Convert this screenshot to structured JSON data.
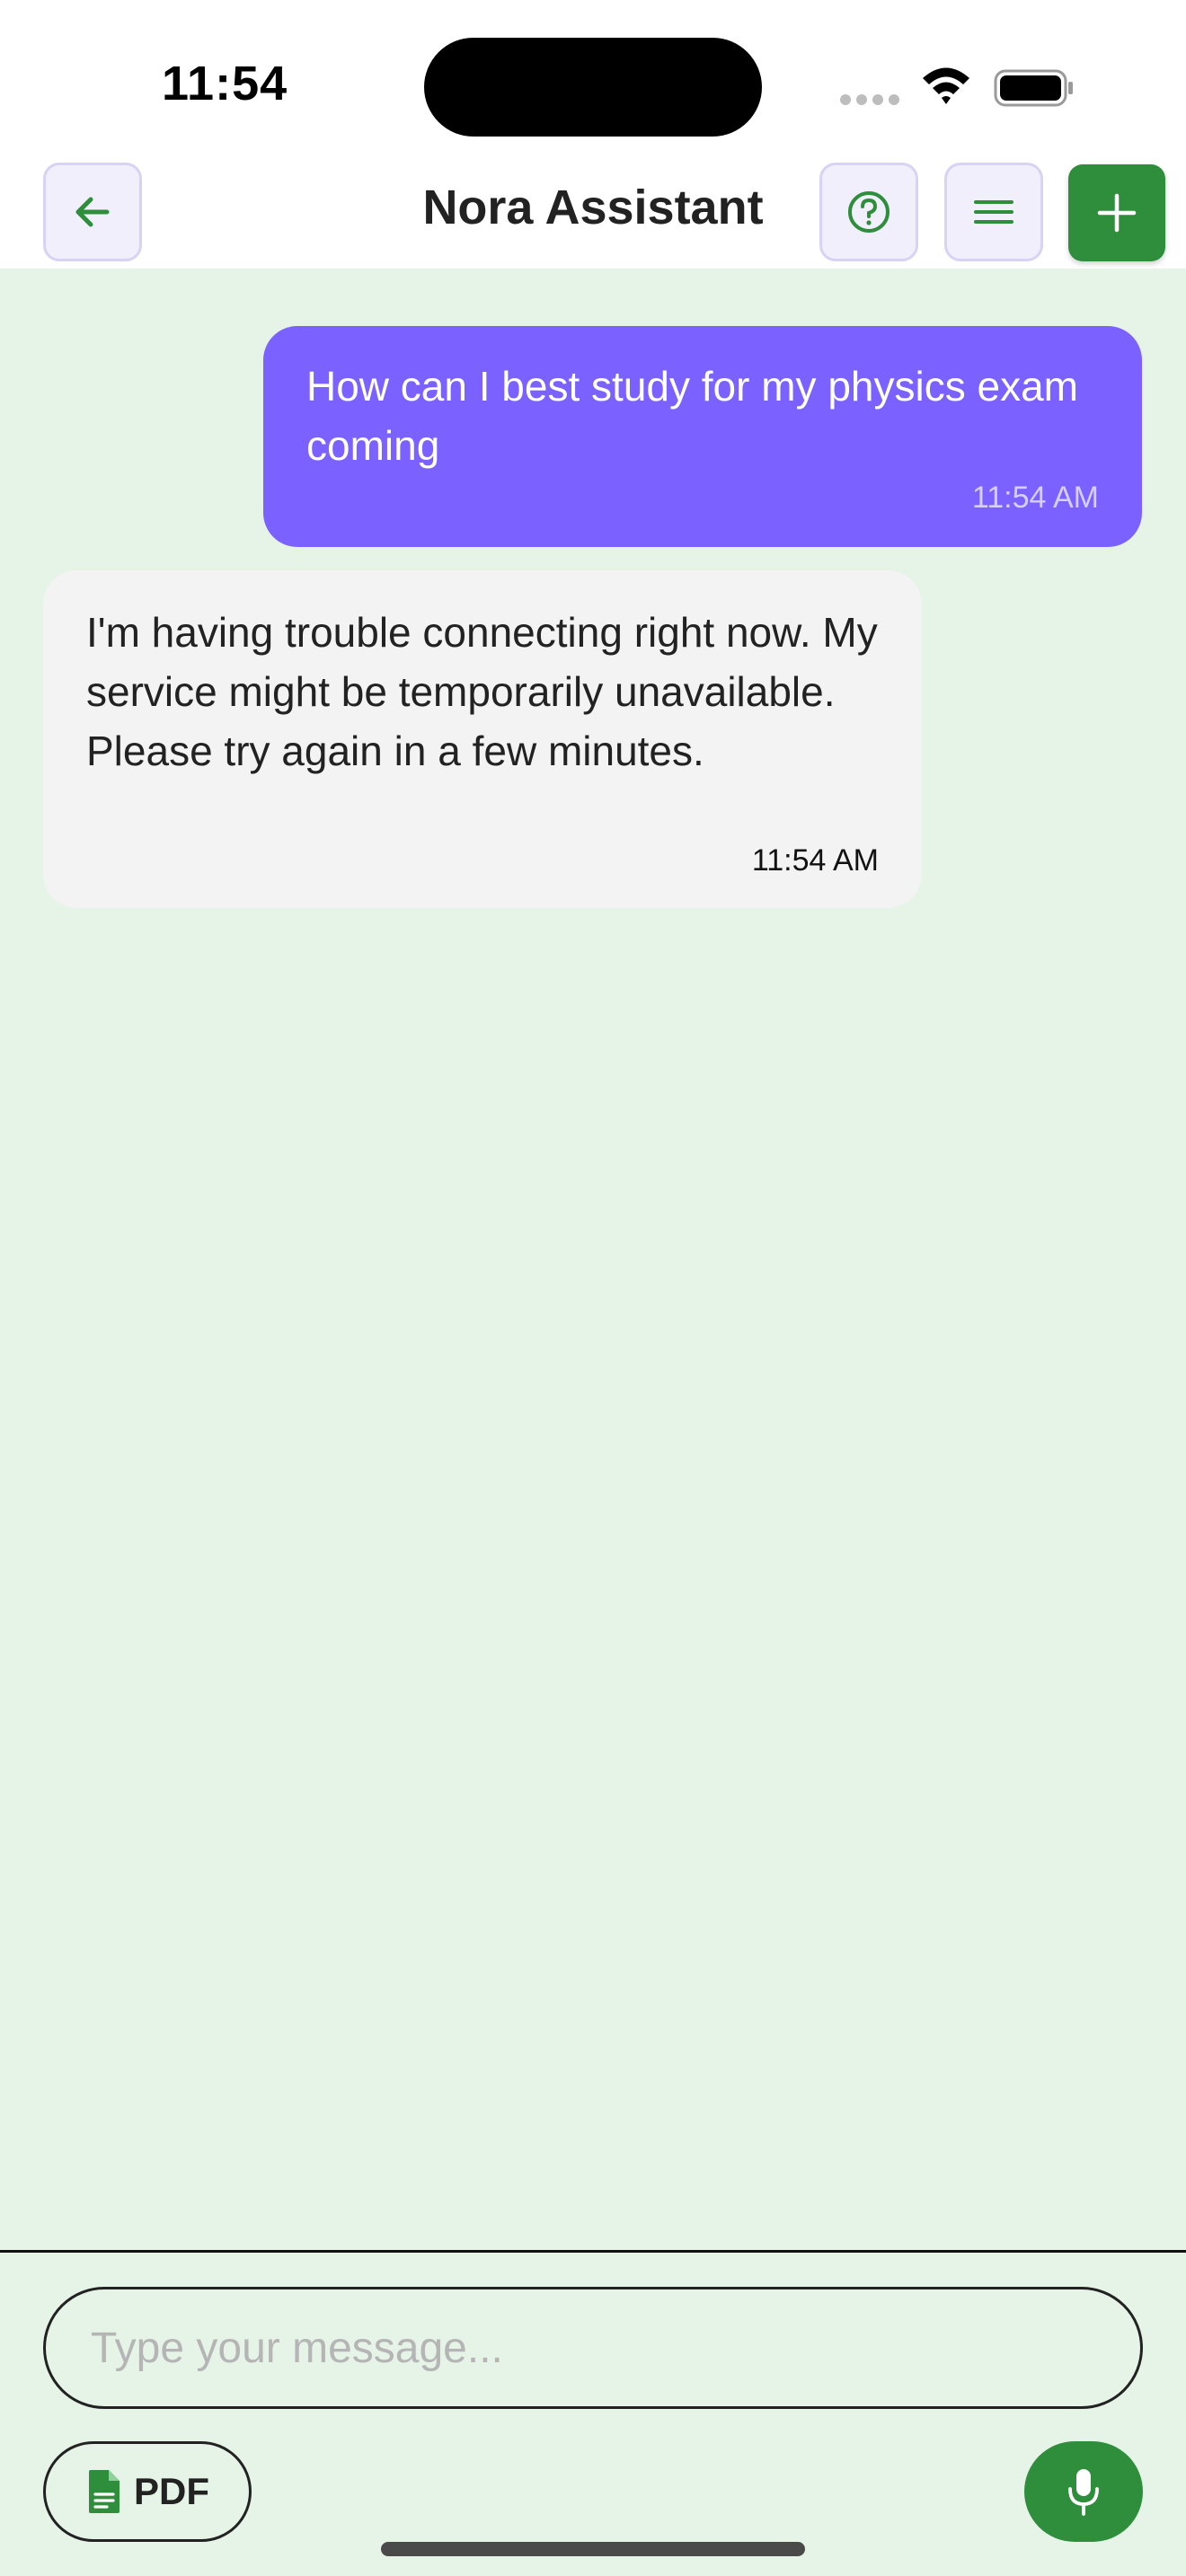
{
  "status_bar": {
    "time": "11:54"
  },
  "header": {
    "title": "Nora Assistant",
    "back_icon": "arrow-left-icon",
    "help_icon": "question-circle-icon",
    "menu_icon": "hamburger-menu-icon",
    "add_icon": "plus-icon"
  },
  "messages": [
    {
      "role": "user",
      "text": "How can I best study for my physics exam coming",
      "time": "11:54 AM"
    },
    {
      "role": "assistant",
      "text": "I'm having trouble connecting right now. My service might be temporarily unavailable. Please try again in a few minutes.",
      "time": "11:54 AM"
    }
  ],
  "composer": {
    "placeholder": "Type your message...",
    "pdf_label": "PDF",
    "pdf_icon": "file-document-icon",
    "mic_icon": "microphone-icon"
  },
  "colors": {
    "background": "#e6f4e8",
    "accent_green": "#2f8e3b",
    "user_bubble": "#7b61ff",
    "assistant_bubble": "#f3f3f3"
  }
}
